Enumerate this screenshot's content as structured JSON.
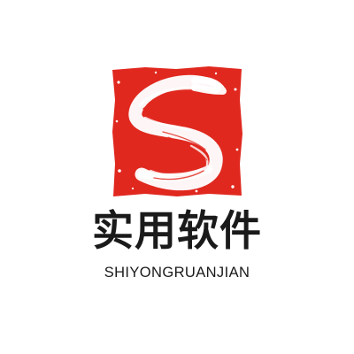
{
  "logo": {
    "seal_letter": "S",
    "seal_color": "#e0281f",
    "background_color": "#ffffff"
  },
  "brand": {
    "title": "实用软件",
    "subtitle": "SHIYONGRUANJIAN",
    "text_color": "#1a1a1a"
  }
}
